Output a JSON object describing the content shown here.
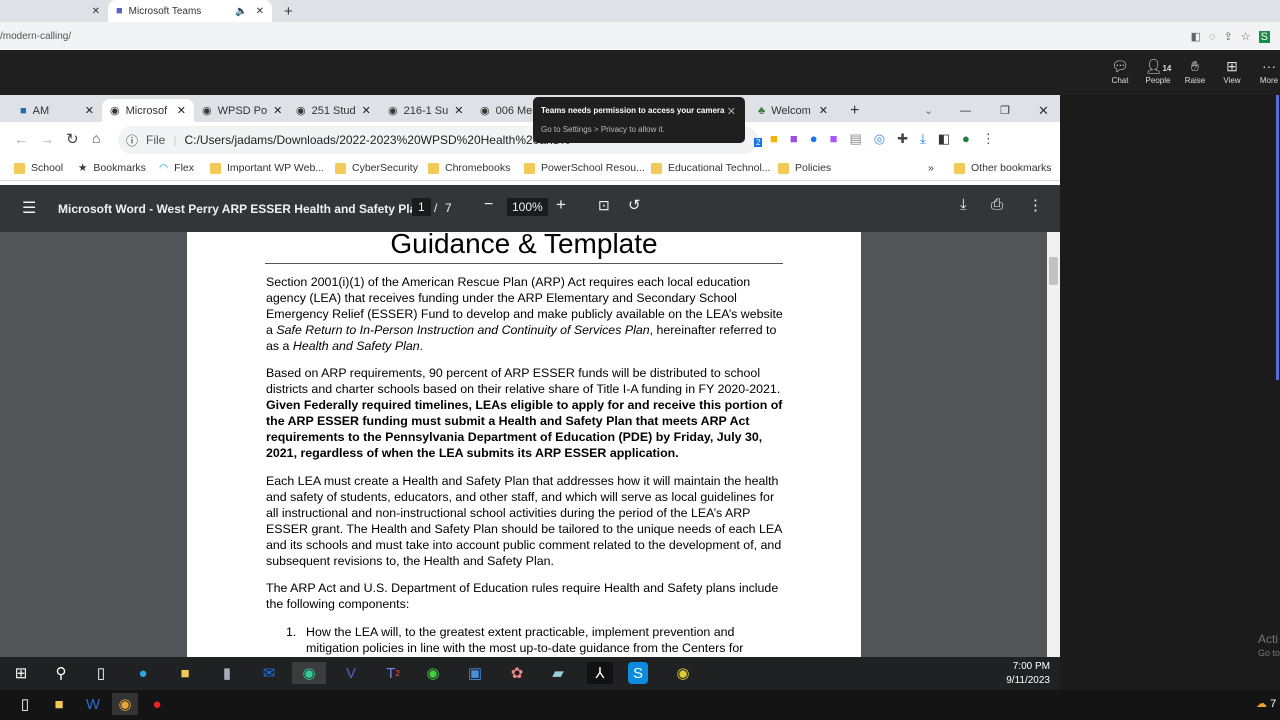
{
  "outer_browser": {
    "tabs": [
      {
        "label": ""
      },
      {
        "label": "Microsoft Teams",
        "active": true
      }
    ],
    "url": "/modern-calling/"
  },
  "teams": {
    "buttons": [
      {
        "label": "Chat",
        "icon": "chat-icon"
      },
      {
        "label": "People",
        "icon": "people-icon",
        "count": "14"
      },
      {
        "label": "Raise",
        "icon": "hand-icon"
      },
      {
        "label": "View",
        "icon": "grid-icon"
      },
      {
        "label": "More",
        "icon": "more-icon"
      }
    ]
  },
  "toast": {
    "title": "Teams needs permission to access your camera",
    "body": "Go to Settings > Privacy to allow it."
  },
  "inner_browser": {
    "tabs": [
      {
        "label": "AM"
      },
      {
        "label": "Microsof",
        "active": true
      },
      {
        "label": "WPSD Po"
      },
      {
        "label": "251 Stud"
      },
      {
        "label": "216-1 Su"
      },
      {
        "label": "006 Me"
      },
      {
        "label": "Welcom"
      }
    ],
    "omnibox": {
      "scheme": "File",
      "url": "C:/Users/jadams/Downloads/2022-2023%20WPSD%20Health%20and%"
    },
    "extension_badge": "2",
    "bookmarks": [
      {
        "label": "School",
        "icon": "folder"
      },
      {
        "label": "Bookmarks",
        "icon": "star"
      },
      {
        "label": "Flex",
        "icon": "flex"
      },
      {
        "label": "Important WP Web...",
        "icon": "folder"
      },
      {
        "label": "CyberSecurity",
        "icon": "folder"
      },
      {
        "label": "Chromebooks",
        "icon": "folder"
      },
      {
        "label": "PowerSchool Resou...",
        "icon": "folder"
      },
      {
        "label": "Educational Technol...",
        "icon": "folder"
      },
      {
        "label": "Policies",
        "icon": "folder"
      }
    ],
    "bookmarks_more": "»",
    "other_bookmarks": "Other bookmarks"
  },
  "pdf": {
    "title": "Microsoft Word - West Perry ARP ESSER Health and Safety Pla...",
    "page": "1",
    "separator": "/",
    "total_pages": "7",
    "zoom": "100%"
  },
  "document": {
    "heading": "Guidance & Template",
    "p1": {
      "a": "Section 2001(i)(1) of the American Rescue Plan (ARP) Act requires each local education agency (LEA) that receives funding under the ARP Elementary and Secondary School Emergency Relief (ESSER) Fund to develop and make publicly available on the LEA’s website a ",
      "i1": "Safe Return to In-Person Instruction and Continuity of Services Plan",
      "b": ", hereinafter referred to as a ",
      "i2": "Health and Safety Plan",
      "c": "."
    },
    "p2": {
      "a": "Based on ARP requirements, 90 percent of ARP ESSER funds will be distributed to school districts and charter schools based on their relative share of Title I-A funding in FY 2020-2021. ",
      "bold": "Given Federally required timelines, LEAs eligible to apply for and receive this portion of the ARP ESSER funding must submit a Health and Safety Plan that meets ARP Act requirements to the Pennsylvania Department of Education (PDE) by Friday, July 30, 2021, regardless of when the LEA submits its ARP ESSER application."
    },
    "p3": "Each LEA must create a Health and Safety Plan that addresses how it will maintain the health and safety of students, educators, and other staff, and which will serve as local guidelines for all instructional and non-instructional school activities during the period of the LEA’s ARP ESSER grant. The Health and Safety Plan should be tailored to the unique needs of each LEA and its schools and must take into account public comment related to the development of, and subsequent revisions to, the Health and Safety Plan.",
    "p4": "The ARP Act and U.S. Department of Education rules require Health and Safety plans include the following components:",
    "li1_num": "1.",
    "li1": "How the LEA will, to the greatest extent practicable, implement prevention and mitigation policies in line with the most up-to-date guidance from the Centers for Disease Control"
  },
  "taskbar": {
    "time": "7:00 PM",
    "date": "9/11/2023",
    "teams_badge": "2"
  },
  "watermark": {
    "line1": "Acti",
    "line2": "Go to"
  },
  "weather": {
    "temp": "7"
  }
}
